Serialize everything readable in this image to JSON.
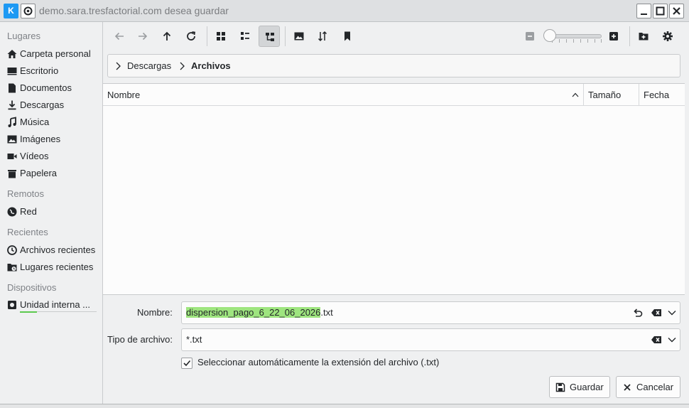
{
  "window": {
    "title": "demo.sara.tresfactorial.com desea guardar",
    "logo_text": "K"
  },
  "sidebar": {
    "sections": [
      {
        "title": "Lugares"
      },
      {
        "title": "Remotos"
      },
      {
        "title": "Recientes"
      },
      {
        "title": "Dispositivos"
      }
    ],
    "places": [
      {
        "label": "Carpeta personal",
        "icon": "home-icon"
      },
      {
        "label": "Escritorio",
        "icon": "desktop-icon"
      },
      {
        "label": "Documentos",
        "icon": "document-icon"
      },
      {
        "label": "Descargas",
        "icon": "download-icon"
      },
      {
        "label": "Música",
        "icon": "music-icon"
      },
      {
        "label": "Imágenes",
        "icon": "image-icon"
      },
      {
        "label": "Vídeos",
        "icon": "video-icon"
      },
      {
        "label": "Papelera",
        "icon": "trash-icon"
      }
    ],
    "remote": [
      {
        "label": "Red",
        "icon": "network-icon"
      }
    ],
    "recent": [
      {
        "label": "Archivos recientes",
        "icon": "clock-icon"
      },
      {
        "label": "Lugares recientes",
        "icon": "folder-clock-icon"
      }
    ],
    "devices": [
      {
        "label": "Unidad interna ...",
        "icon": "drive-icon"
      }
    ]
  },
  "breadcrumb": {
    "items": [
      "Descargas",
      "Archivos"
    ]
  },
  "columns": {
    "name": "Nombre",
    "size": "Tamaño",
    "date": "Fecha"
  },
  "form": {
    "name_label": "Nombre:",
    "name_value_selected": "dispersion_pago_6_22_06_2026",
    "name_value_ext": ".txt",
    "type_label": "Tipo de archivo:",
    "type_value": "*.txt",
    "auto_ext_label": "Seleccionar automáticamente la extensión del archivo (.txt)",
    "auto_ext_checked": true
  },
  "buttons": {
    "save": "Guardar",
    "cancel": "Cancelar"
  },
  "colors": {
    "accent": "#3daee9",
    "selection": "#9ee57f"
  }
}
